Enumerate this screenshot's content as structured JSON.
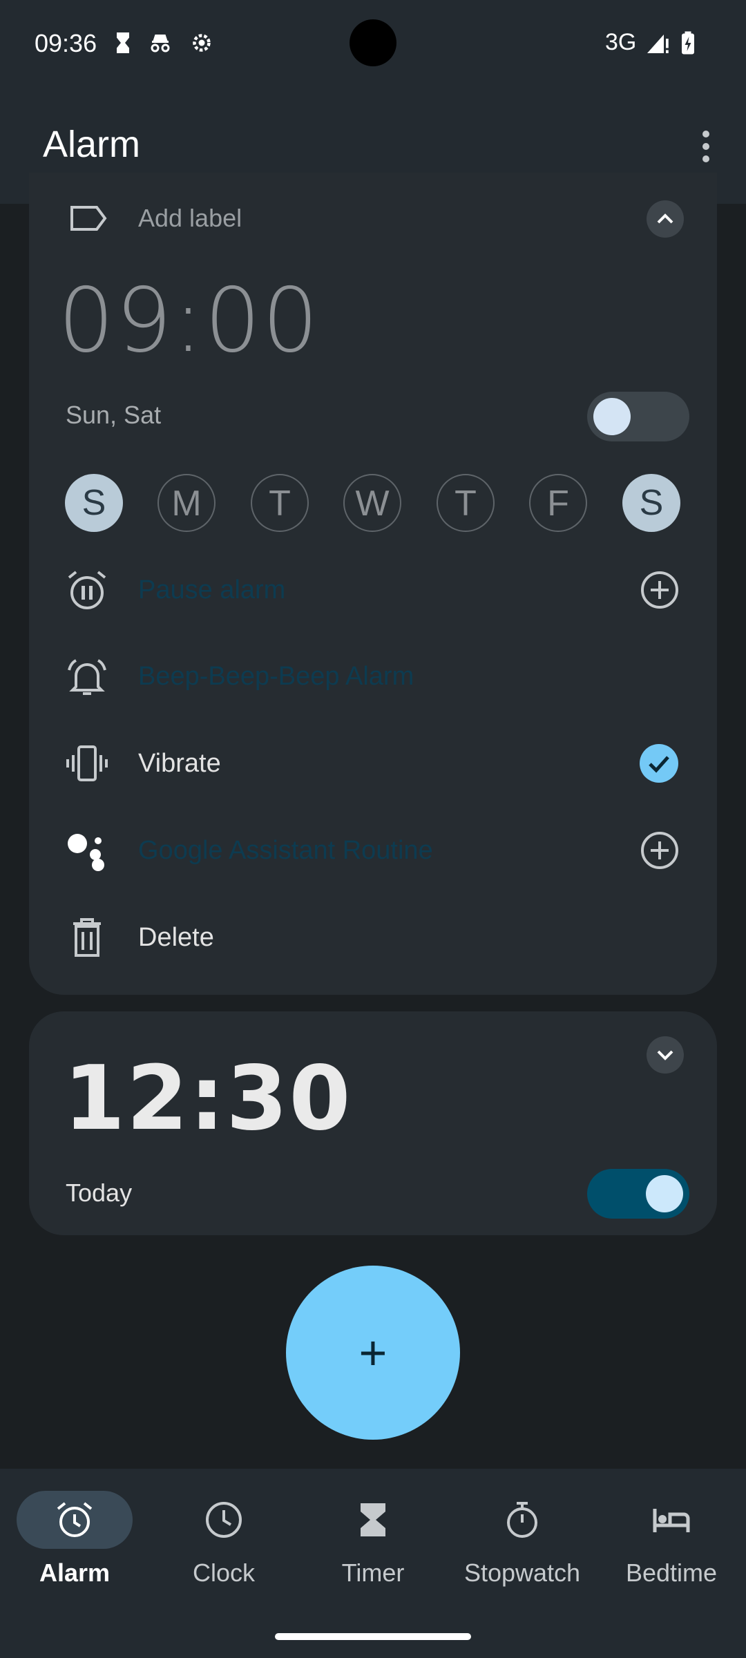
{
  "status_bar": {
    "time": "09:36",
    "network": "3G"
  },
  "app_bar": {
    "title": "Alarm"
  },
  "alarm1": {
    "label_placeholder": "Add label",
    "time": "09:00",
    "repeat_text": "Sun, Sat",
    "enabled": false,
    "days": [
      {
        "letter": "S",
        "selected": true
      },
      {
        "letter": "M",
        "selected": false
      },
      {
        "letter": "T",
        "selected": false
      },
      {
        "letter": "W",
        "selected": false
      },
      {
        "letter": "T",
        "selected": false
      },
      {
        "letter": "F",
        "selected": false
      },
      {
        "letter": "S",
        "selected": true
      }
    ],
    "options": {
      "pause": "Pause alarm",
      "sound": "Beep-Beep-Beep Alarm",
      "vibrate": "Vibrate",
      "assistant": "Google Assistant Routine",
      "delete": "Delete"
    }
  },
  "alarm2": {
    "time": "12:30",
    "repeat_text": "Today",
    "enabled": true
  },
  "fab": {
    "symbol": "+"
  },
  "bottom_nav": {
    "items": [
      {
        "label": "Alarm",
        "icon": "alarm-icon",
        "active": true
      },
      {
        "label": "Clock",
        "icon": "clock-icon",
        "active": false
      },
      {
        "label": "Timer",
        "icon": "hourglass-icon",
        "active": false
      },
      {
        "label": "Stopwatch",
        "icon": "stopwatch-icon",
        "active": false
      },
      {
        "label": "Bedtime",
        "icon": "bed-icon",
        "active": false
      }
    ]
  },
  "colors": {
    "accent": "#74cdfa",
    "background": "#1b1f22",
    "card": "#262c31",
    "switch_on": "#004f6b"
  }
}
